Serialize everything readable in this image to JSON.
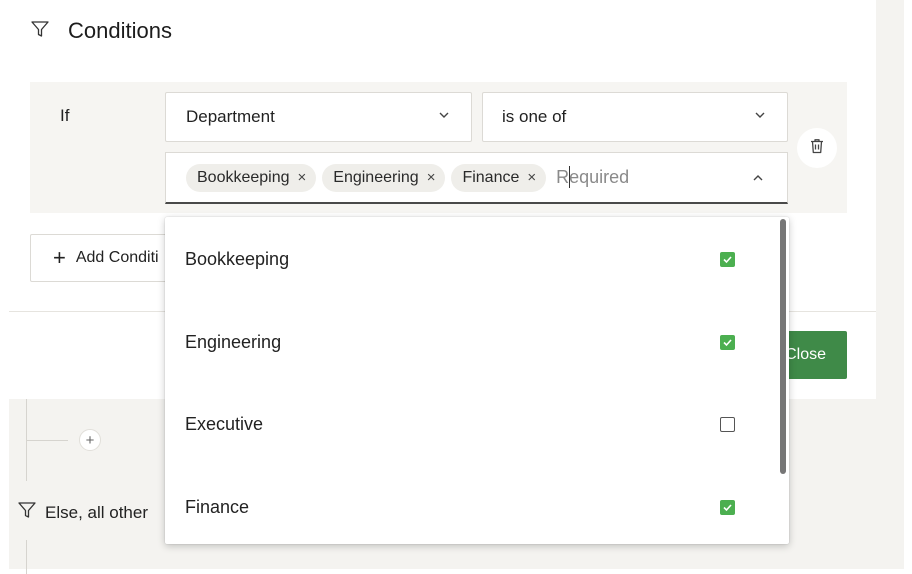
{
  "conditions": {
    "title": "Conditions",
    "if_label": "If",
    "field_select": {
      "value": "Department"
    },
    "operator_select": {
      "value": "is one of"
    },
    "values_input": {
      "chips": [
        {
          "label": "Bookkeeping",
          "remove": "×"
        },
        {
          "label": "Engineering",
          "remove": "×"
        },
        {
          "label": "Finance",
          "remove": "×"
        }
      ],
      "placeholder": "Required"
    },
    "add_condition_label": "Add Conditi"
  },
  "footer": {
    "close_label": "Close"
  },
  "workflow": {
    "add_symbol": "+",
    "else_label": "Else, all other"
  },
  "dropdown": {
    "options": [
      {
        "label": "Bookkeeping",
        "checked": true
      },
      {
        "label": "Engineering",
        "checked": true
      },
      {
        "label": "Executive",
        "checked": false
      },
      {
        "label": "Finance",
        "checked": true
      }
    ]
  },
  "colors": {
    "accent_green": "#3f8a48",
    "checkbox_green": "#4caf50",
    "panel_bg": "#f6f5f2"
  },
  "icons": {
    "conditions": "filter-icon",
    "dropdown_closed": "chevron-down-icon",
    "dropdown_open": "chevron-up-icon",
    "delete": "trash-icon",
    "add": "plus-icon",
    "checked": "checkbox-checked-icon",
    "unchecked": "checkbox-empty-icon"
  }
}
